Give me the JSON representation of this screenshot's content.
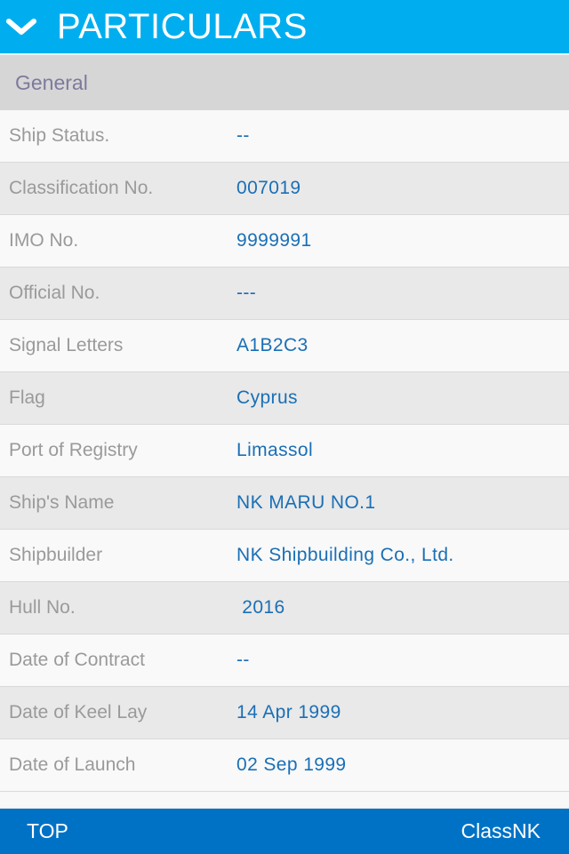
{
  "header": {
    "title": "PARTICULARS",
    "collapse_icon": "chevron-down-icon"
  },
  "section": {
    "title": "General"
  },
  "rows": [
    {
      "label": "Ship Status.",
      "value": "--"
    },
    {
      "label": "Classification No.",
      "value": "007019"
    },
    {
      "label": "IMO No.",
      "value": "9999991"
    },
    {
      "label": "Official No.",
      "value": "---"
    },
    {
      "label": "Signal Letters",
      "value": "A1B2C3"
    },
    {
      "label": "Flag",
      "value": "Cyprus"
    },
    {
      "label": "Port of Registry",
      "value": "Limassol"
    },
    {
      "label": "Ship's Name",
      "value": "NK MARU NO.1"
    },
    {
      "label": "Shipbuilder",
      "value": "NK Shipbuilding Co., Ltd."
    },
    {
      "label": "Hull No.",
      "value": " 2016"
    },
    {
      "label": "Date of Contract",
      "value": "--"
    },
    {
      "label": "Date of Keel Lay",
      "value": "14 Apr 1999"
    },
    {
      "label": "Date of Launch",
      "value": "02 Sep 1999"
    }
  ],
  "footer": {
    "top_label": "TOP",
    "brand_label": "ClassNK"
  },
  "colors": {
    "header": "#00aeef",
    "footer": "#0072c6",
    "value_text": "#1a6fb6",
    "label_text": "#9a9a9a"
  }
}
